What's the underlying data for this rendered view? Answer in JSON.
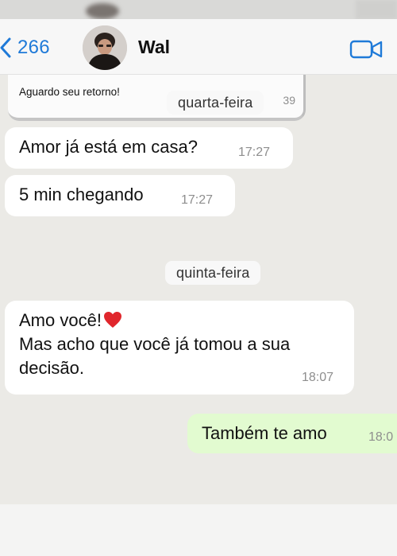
{
  "header": {
    "back_count": "266",
    "contact_name": "Wal"
  },
  "quoted_message": {
    "text": "Aguardo seu retorno!",
    "time_fragment": "39"
  },
  "date_separators": {
    "first": "quarta-feira",
    "second": "quinta-feira"
  },
  "messages": [
    {
      "text": "Amor já está em casa?",
      "time": "17:27"
    },
    {
      "text": "5 min chegando",
      "time": "17:27"
    },
    {
      "line1": "Amo você!",
      "line2": "Mas acho que você já tomou a sua",
      "line3": "decisão.",
      "time": "18:07"
    },
    {
      "text": "Também te amo",
      "time": "18:0"
    }
  ],
  "colors": {
    "accent_blue": "#1f7ad8",
    "incoming_bubble": "#ffffff",
    "outgoing_bubble": "#e2fbd0",
    "chat_background": "#ebeae6",
    "heart_red": "#e0262c"
  },
  "icons": {
    "back": "chevron-left-icon",
    "video": "video-camera-icon",
    "heart": "red-heart-emoji"
  }
}
